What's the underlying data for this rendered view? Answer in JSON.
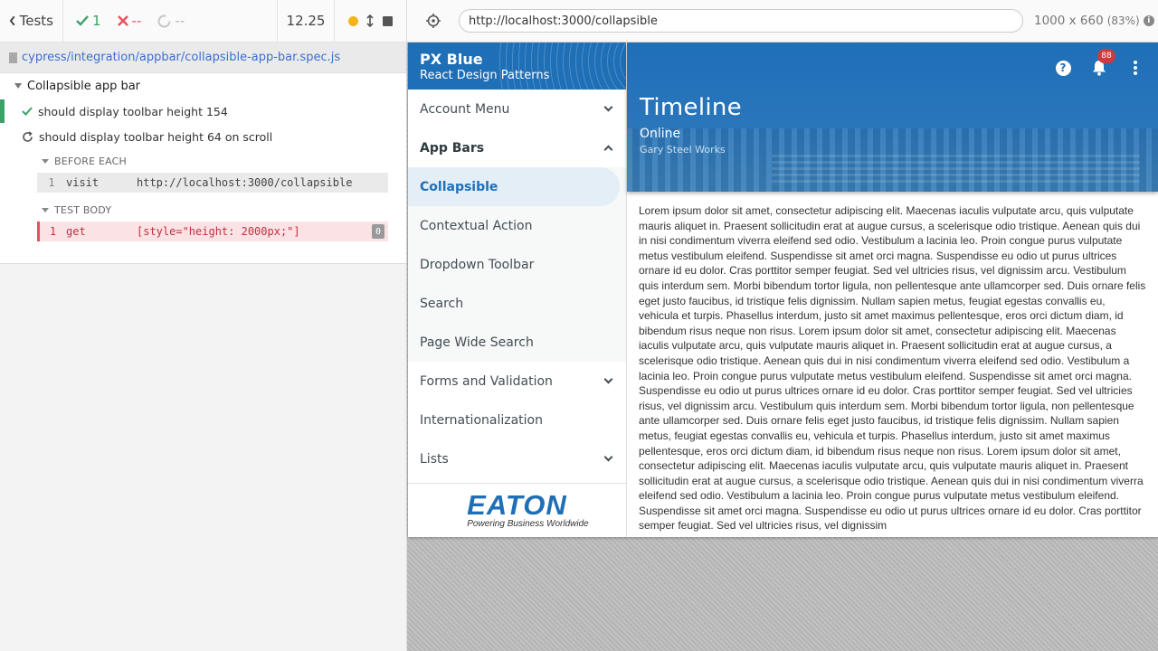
{
  "reporter": {
    "tests_label": "Tests",
    "passed": "1",
    "failed": "--",
    "pending": "--",
    "duration": "12.25",
    "spec_path": "cypress/integration/appbar/collapsible-app-bar.spec.js",
    "suite_title": "Collapsible app bar",
    "tests": [
      {
        "title": "should display toolbar height 154",
        "state": "passed"
      },
      {
        "title": "should display toolbar height 64 on scroll",
        "state": "running"
      }
    ],
    "before_each_label": "BEFORE EACH",
    "test_body_label": "TEST BODY",
    "before_each_cmd": {
      "num": "1",
      "name": "visit",
      "arg": "http://localhost:3000/collapsible"
    },
    "body_cmd": {
      "num": "1",
      "name": "get",
      "arg": "[style=\"height: 2000px;\"]",
      "count": "0"
    }
  },
  "aut": {
    "url": "http://localhost:3000/collapsible",
    "viewport": "1000 x 660",
    "scale": "(83%)",
    "info_glyph": "i"
  },
  "app": {
    "drawer_title": "PX Blue",
    "drawer_subtitle": "React Design Patterns",
    "nav": [
      {
        "label": "Account Menu",
        "expandable": true
      },
      {
        "label": "App Bars",
        "expanded": true
      },
      {
        "label": "Collapsible",
        "active": true
      },
      {
        "label": "Contextual Action"
      },
      {
        "label": "Dropdown Toolbar"
      },
      {
        "label": "Search"
      },
      {
        "label": "Page Wide Search"
      },
      {
        "label": "Forms and Validation",
        "expandable": true
      },
      {
        "label": "Internationalization"
      },
      {
        "label": "Lists",
        "expandable": true
      }
    ],
    "logo_text": "EATON",
    "logo_tagline": "Powering Business Worldwide",
    "appbar_title": "Timeline",
    "appbar_subtitle": "Online",
    "appbar_info": "Gary Steel Works",
    "help_glyph": "?",
    "notification_count": "88",
    "brand_color": "#1f6fb7",
    "body_text": "Lorem ipsum dolor sit amet, consectetur adipiscing elit. Maecenas iaculis vulputate arcu, quis vulputate mauris aliquet in. Praesent sollicitudin erat at augue cursus, a scelerisque odio tristique. Aenean quis dui in nisi condimentum viverra eleifend sed odio. Vestibulum a lacinia leo. Proin congue purus vulputate metus vestibulum eleifend. Suspendisse sit amet orci magna. Suspendisse eu odio ut purus ultrices ornare id eu dolor. Cras porttitor semper feugiat. Sed vel ultricies risus, vel dignissim arcu. Vestibulum quis interdum sem. Morbi bibendum tortor ligula, non pellentesque ante ullamcorper sed. Duis ornare felis eget justo faucibus, id tristique felis dignissim. Nullam sapien metus, feugiat egestas convallis eu, vehicula et turpis. Phasellus interdum, justo sit amet maximus pellentesque, eros orci dictum diam, id bibendum risus neque non risus. Lorem ipsum dolor sit amet, consectetur adipiscing elit. Maecenas iaculis vulputate arcu, quis vulputate mauris aliquet in. Praesent sollicitudin erat at augue cursus, a scelerisque odio tristique. Aenean quis dui in nisi condimentum viverra eleifend sed odio. Vestibulum a lacinia leo. Proin congue purus vulputate metus vestibulum eleifend. Suspendisse sit amet orci magna. Suspendisse eu odio ut purus ultrices ornare id eu dolor. Cras porttitor semper feugiat. Sed vel ultricies risus, vel dignissim arcu. Vestibulum quis interdum sem. Morbi bibendum tortor ligula, non pellentesque ante ullamcorper sed. Duis ornare felis eget justo faucibus, id tristique felis dignissim. Nullam sapien metus, feugiat egestas convallis eu, vehicula et turpis. Phasellus interdum, justo sit amet maximus pellentesque, eros orci dictum diam, id bibendum risus neque non risus. Lorem ipsum dolor sit amet, consectetur adipiscing elit. Maecenas iaculis vulputate arcu, quis vulputate mauris aliquet in. Praesent sollicitudin erat at augue cursus, a scelerisque odio tristique. Aenean quis dui in nisi condimentum viverra eleifend sed odio. Vestibulum a lacinia leo. Proin congue purus vulputate metus vestibulum eleifend. Suspendisse sit amet orci magna. Suspendisse eu odio ut purus ultrices ornare id eu dolor. Cras porttitor semper feugiat. Sed vel ultricies risus, vel dignissim"
  }
}
